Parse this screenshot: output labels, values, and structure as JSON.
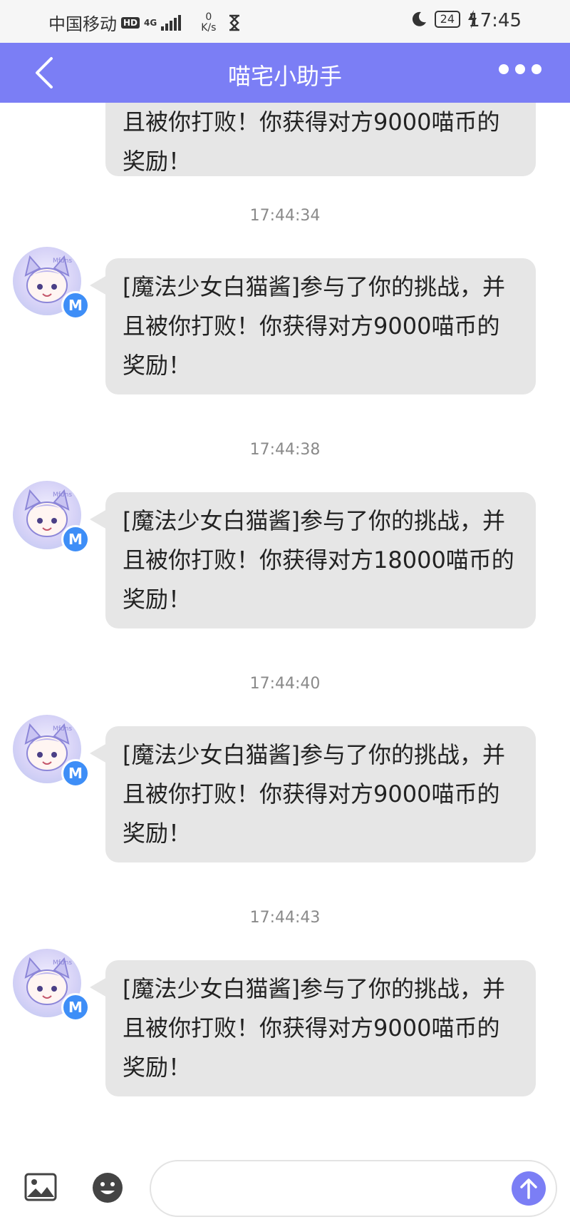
{
  "status_bar": {
    "carrier": "中国移动",
    "hd_badge": "HD",
    "network": "4G",
    "net_speed_value": "0",
    "net_speed_unit": "K/s",
    "battery": "24",
    "time": "17:45"
  },
  "header": {
    "title": "喵宅小助手"
  },
  "messages": [
    {
      "timestamp": "",
      "text": "且被你打败！你获得对方9000喵币的奖励！"
    },
    {
      "timestamp": "17:44:34",
      "text": "[魔法少女白猫酱]参与了你的挑战，并且被你打败！你获得对方9000喵币的奖励！"
    },
    {
      "timestamp": "17:44:38",
      "text": "[魔法少女白猫酱]参与了你的挑战，并且被你打败！你获得对方18000喵币的奖励！"
    },
    {
      "timestamp": "17:44:40",
      "text": "[魔法少女白猫酱]参与了你的挑战，并且被你打败！你获得对方9000喵币的奖励！"
    },
    {
      "timestamp": "17:44:43",
      "text": "[魔法少女白猫酱]参与了你的挑战，并且被你打败！你获得对方9000喵币的奖励！"
    }
  ],
  "avatar": {
    "badge": "M",
    "caption": "Mfuns"
  },
  "input_bar": {
    "placeholder": ""
  },
  "colors": {
    "accent": "#7b7ef5",
    "bubble": "#e6e6e6",
    "badge_blue": "#3e8ef7"
  }
}
